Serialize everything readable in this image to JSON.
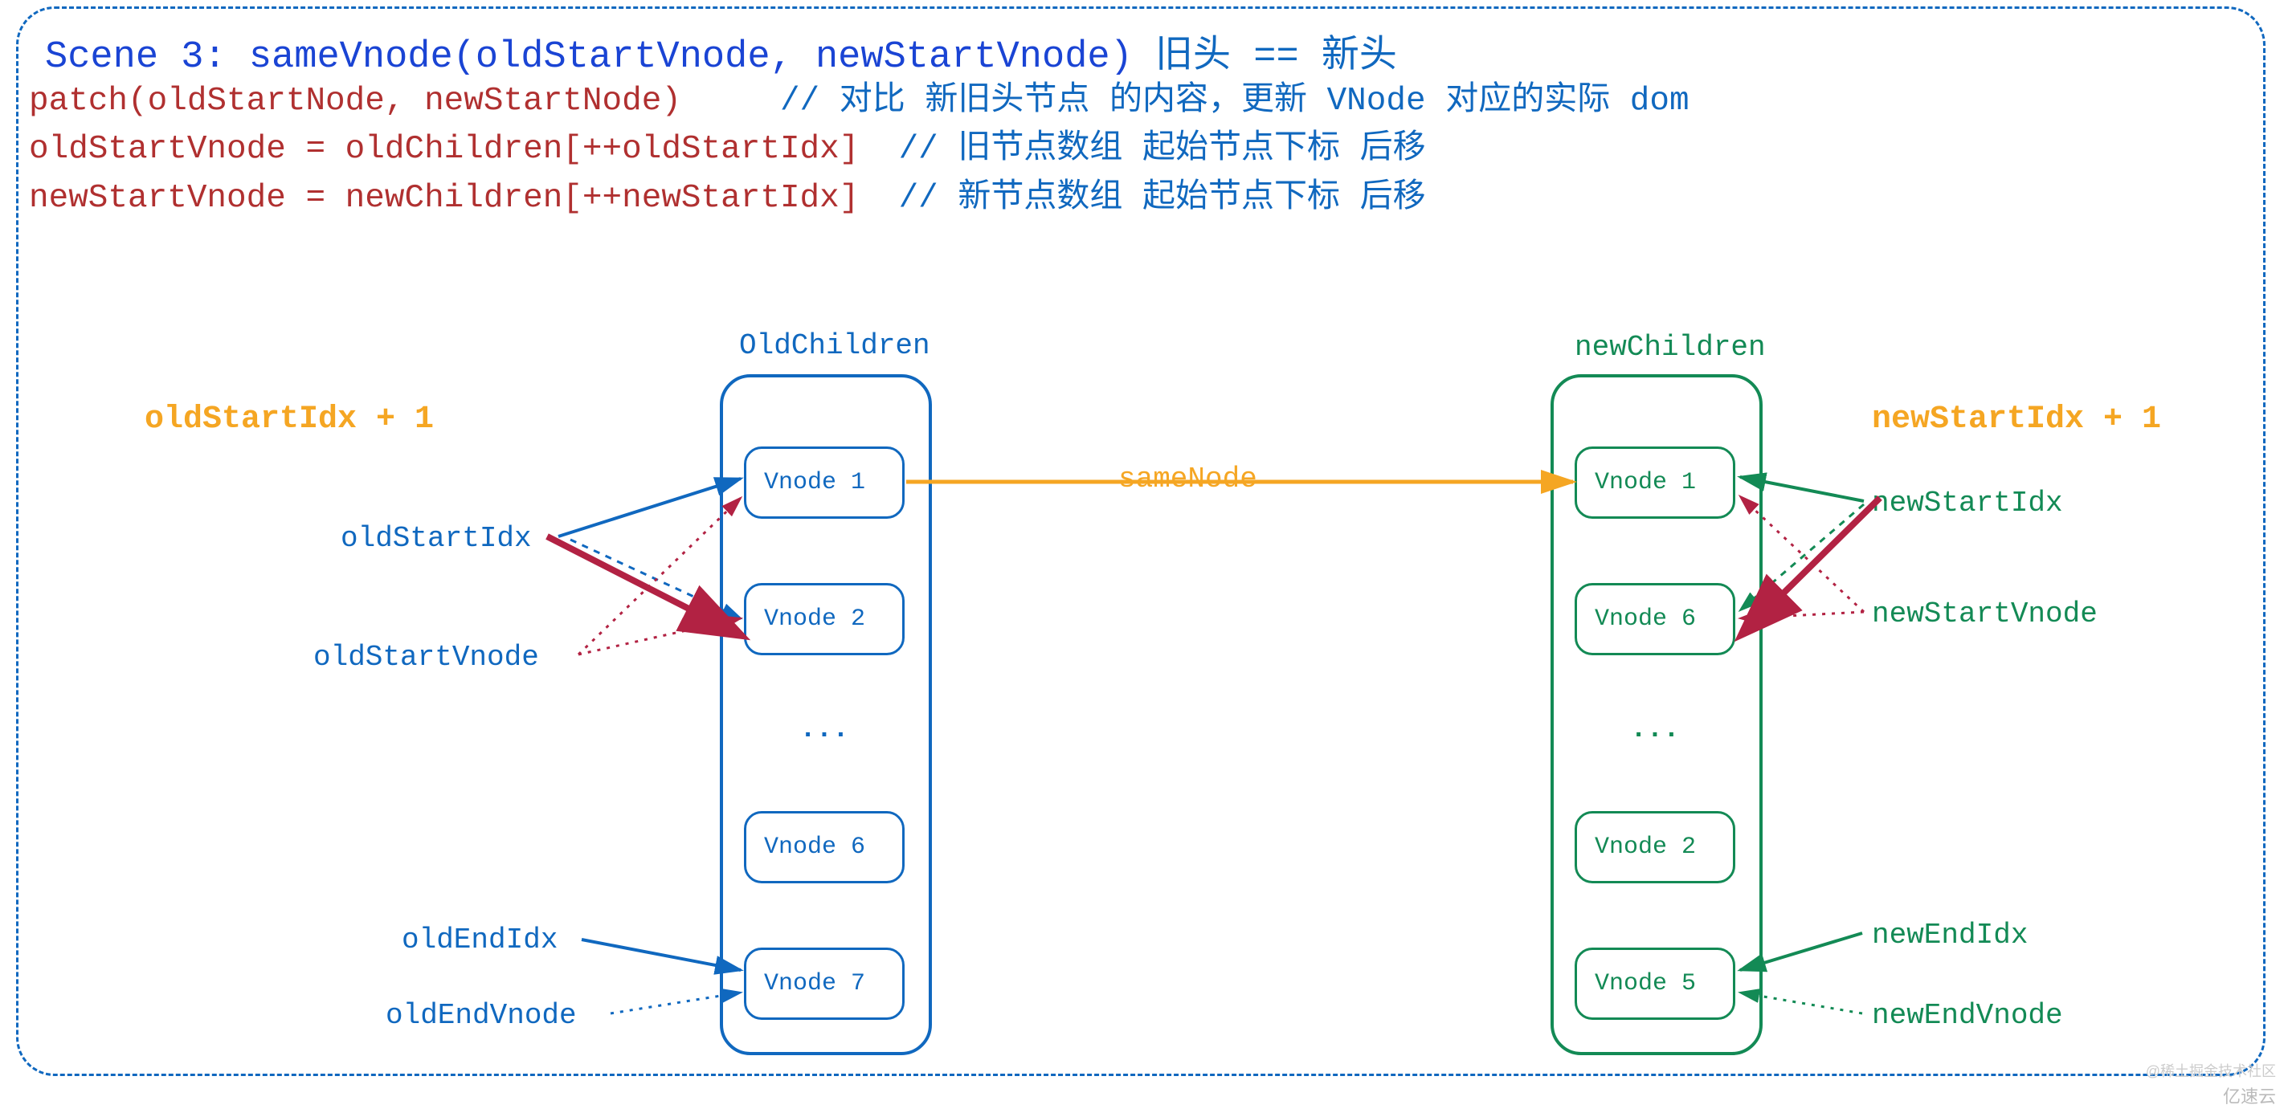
{
  "title_en": "Scene 3: sameVnode(oldStartVnode, newStartVnode) ",
  "title_cn": "旧头 == 新头",
  "code_line1_a": "patch(oldStartNode, newStartNode)     ",
  "code_line1_b": "// 对比 新旧头节点 的内容，更新 VNode 对应的实际 dom",
  "code_line2_a": "oldStartVnode = oldChildren[++oldStartIdx]  ",
  "code_line2_b": "// 旧节点数组 起始节点下标 后移",
  "code_line3_a": "newStartVnode = newChildren[++newStartIdx]  ",
  "code_line3_b": "// 新节点数组 起始节点下标 后移",
  "oldChildren_label": "OldChildren",
  "newChildren_label": "newChildren",
  "sameNode": "sameNode",
  "oldStartIdx_plus": "oldStartIdx + 1",
  "newStartIdx_plus": "newStartIdx + 1",
  "old": {
    "n1": "Vnode 1",
    "n2": "Vnode 2",
    "ell": "...",
    "n3": "Vnode 6",
    "n4": "Vnode 7"
  },
  "new": {
    "n1": "Vnode 1",
    "n2": "Vnode 6",
    "ell": "...",
    "n3": "Vnode 2",
    "n4": "Vnode 5"
  },
  "labels": {
    "oldStartIdx": "oldStartIdx",
    "oldStartVnode": "oldStartVnode",
    "oldEndIdx": "oldEndIdx",
    "oldEndVnode": "oldEndVnode",
    "newStartIdx": "newStartIdx",
    "newStartVnode": "newStartVnode",
    "newEndIdx": "newEndIdx",
    "newEndVnode": "newEndVnode"
  },
  "watermark": "亿速云",
  "watermark2": "@稀土掘金技术社区"
}
